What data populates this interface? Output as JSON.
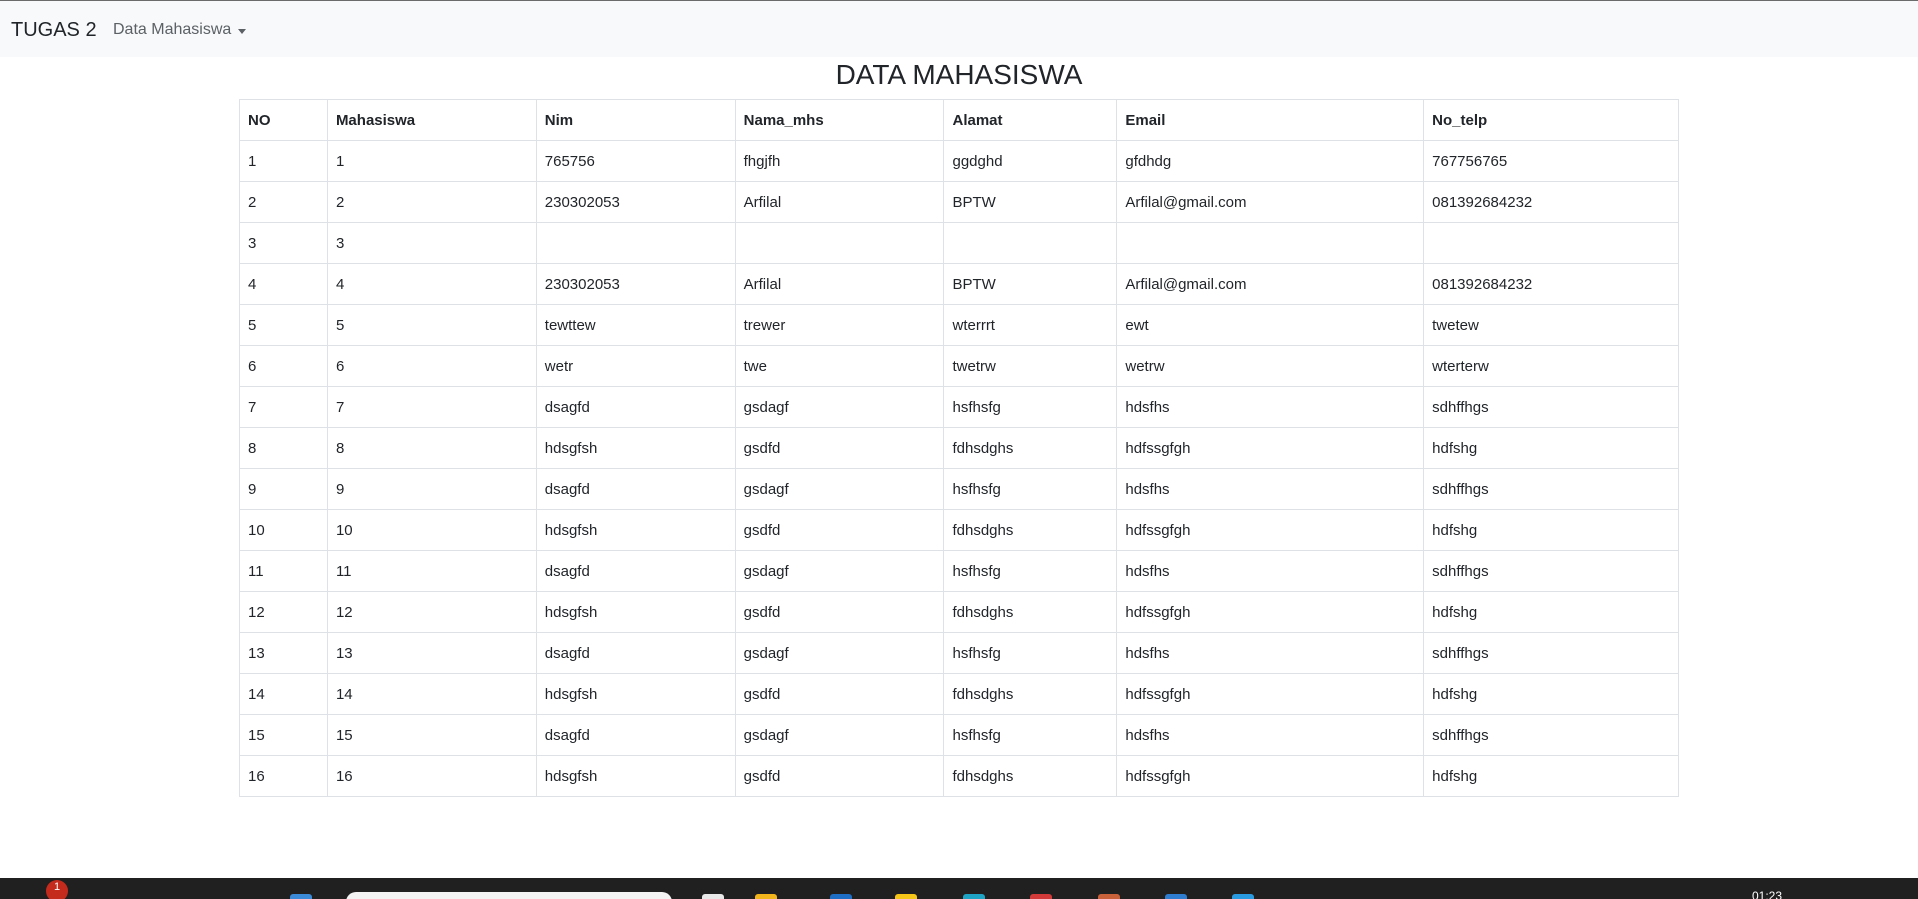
{
  "navbar": {
    "brand": "TUGAS 2",
    "dropdown_label": "Data Mahasiswa"
  },
  "main": {
    "title": "DATA MAHASISWA",
    "table": {
      "columns": [
        "NO",
        "Mahasiswa",
        "Nim",
        "Nama_mhs",
        "Alamat",
        "Email",
        "No_telp"
      ],
      "rows": [
        [
          "1",
          "1",
          "765756",
          "fhgjfh",
          "ggdghd",
          "gfdhdg",
          "767756765"
        ],
        [
          "2",
          "2",
          "230302053",
          "Arfilal",
          "BPTW",
          "Arfilal@gmail.com",
          "081392684232"
        ],
        [
          "3",
          "3",
          "",
          "",
          "",
          "",
          ""
        ],
        [
          "4",
          "4",
          "230302053",
          "Arfilal",
          "BPTW",
          "Arfilal@gmail.com",
          "081392684232"
        ],
        [
          "5",
          "5",
          "tewttew",
          "trewer",
          "wterrrt",
          "ewt",
          "twetew"
        ],
        [
          "6",
          "6",
          "wetr",
          "twe",
          "twetrw",
          "wetrw",
          "wterterw"
        ],
        [
          "7",
          "7",
          "dsagfd",
          "gsdagf",
          "hsfhsfg",
          "hdsfhs",
          "sdhffhgs"
        ],
        [
          "8",
          "8",
          "hdsgfsh",
          "gsdfd",
          "fdhsdghs",
          "hdfssgfgh",
          "hdfshg"
        ],
        [
          "9",
          "9",
          "dsagfd",
          "gsdagf",
          "hsfhsfg",
          "hdsfhs",
          "sdhffhgs"
        ],
        [
          "10",
          "10",
          "hdsgfsh",
          "gsdfd",
          "fdhsdghs",
          "hdfssgfgh",
          "hdfshg"
        ],
        [
          "11",
          "11",
          "dsagfd",
          "gsdagf",
          "hsfhsfg",
          "hdsfhs",
          "sdhffhgs"
        ],
        [
          "12",
          "12",
          "hdsgfsh",
          "gsdfd",
          "fdhsdghs",
          "hdfssgfgh",
          "hdfshg"
        ],
        [
          "13",
          "13",
          "dsagfd",
          "gsdagf",
          "hsfhsfg",
          "hdsfhs",
          "sdhffhgs"
        ],
        [
          "14",
          "14",
          "hdsgfsh",
          "gsdfd",
          "fdhsdghs",
          "hdfssgfgh",
          "hdfshg"
        ],
        [
          "15",
          "15",
          "dsagfd",
          "gsdagf",
          "hsfhsfg",
          "hdsfhs",
          "sdhffhgs"
        ],
        [
          "16",
          "16",
          "hdsgfsh",
          "gsdfd",
          "fdhsdghs",
          "hdfssgfgh",
          "hdfshg"
        ]
      ]
    }
  },
  "taskbar": {
    "notification_count": "1",
    "clock": "01:23",
    "pinned_icons": [
      "widgets-icon",
      "file-explorer-icon",
      "folder-icon",
      "store-icon",
      "chrome-icon",
      "edge-icon",
      "opera-icon",
      "app-icon",
      "calendar-icon",
      "vscode-icon"
    ]
  },
  "colors": {
    "navbar_bg": "#f8f9fa",
    "table_border": "#dee2e6",
    "text": "#212529",
    "taskbar_bg": "#202020",
    "badge": "#c42b1c"
  }
}
